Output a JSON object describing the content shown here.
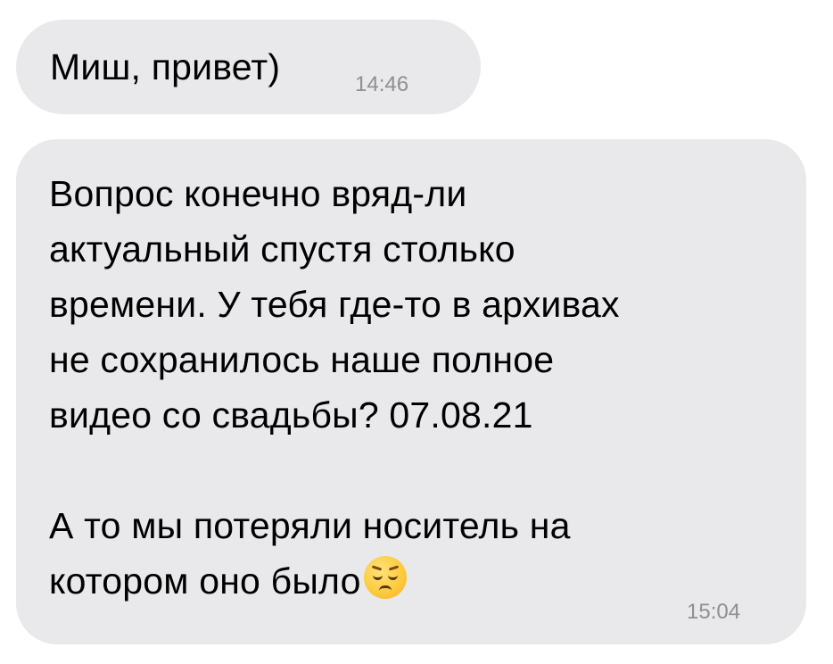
{
  "messages": [
    {
      "lines": [
        "Миш, привет)"
      ],
      "time": "14:46"
    },
    {
      "lines": [
        "Вопрос конечно вряд-ли",
        "актуальный спустя столько",
        "времени. У тебя где-то в архивах",
        "не сохранилось наше полное",
        "видео со свадьбы? 07.08.21",
        "",
        "А то мы потеряли носитель на",
        "котором оно было"
      ],
      "emoji": "pensive-face-icon",
      "time": "15:04"
    }
  ],
  "colors": {
    "bubble_background": "#e9e9eb",
    "text": "#000000",
    "timestamp": "#8e8e93",
    "page_background": "#ffffff"
  }
}
